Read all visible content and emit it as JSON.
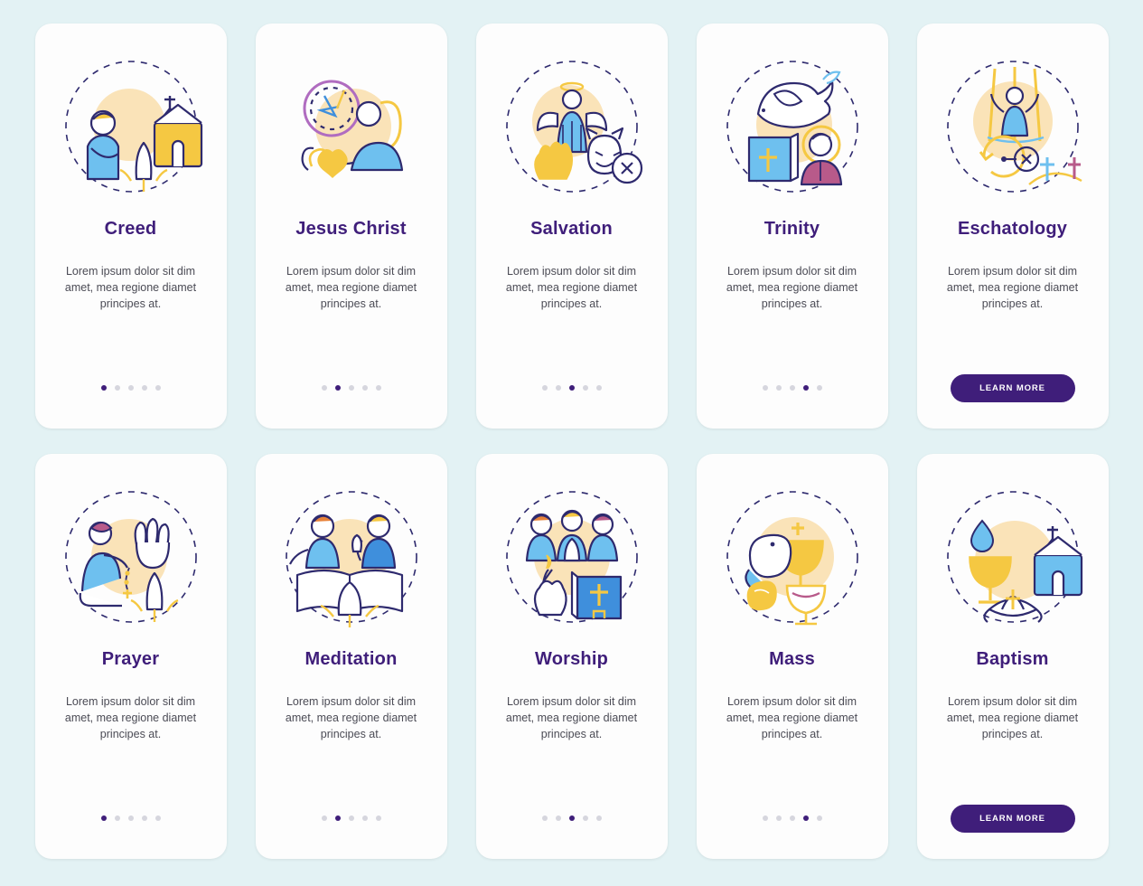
{
  "page": {
    "background": "#e3f2f4",
    "title_color": "#3f1e7a",
    "accent_yellow": "#f5c842",
    "accent_blue": "#4a9be0",
    "accent_peach": "#fae3b8"
  },
  "common": {
    "description": "Lorem ipsum dolor sit dim amet, mea regione diamet principes at.",
    "cta_label": "LEARN MORE"
  },
  "rows": [
    {
      "cards": [
        {
          "title": "Creed",
          "icon": "person-church-praying-icon",
          "active_dot": 0,
          "dot_count": 5,
          "has_cta": false
        },
        {
          "title": "Jesus Christ",
          "icon": "crown-of-thorns-heart-icon",
          "active_dot": 1,
          "dot_count": 5,
          "has_cta": false
        },
        {
          "title": "Salvation",
          "icon": "angel-devil-icon",
          "active_dot": 2,
          "dot_count": 5,
          "has_cta": false
        },
        {
          "title": "Trinity",
          "icon": "dove-bible-saint-icon",
          "active_dot": 3,
          "dot_count": 5,
          "has_cta": false
        },
        {
          "title": "Eschatology",
          "icon": "resurrection-clock-graves-icon",
          "active_dot": 4,
          "dot_count": 5,
          "has_cta": true
        }
      ]
    },
    {
      "cards": [
        {
          "title": "Prayer",
          "icon": "kneeling-rosary-hands-icon",
          "active_dot": 0,
          "dot_count": 5,
          "has_cta": false
        },
        {
          "title": "Meditation",
          "icon": "open-bible-two-people-icon",
          "active_dot": 1,
          "dot_count": 5,
          "has_cta": false
        },
        {
          "title": "Worship",
          "icon": "candle-bible-choir-icon",
          "active_dot": 2,
          "dot_count": 5,
          "has_cta": false
        },
        {
          "title": "Mass",
          "icon": "chalice-bread-wine-icon",
          "active_dot": 3,
          "dot_count": 5,
          "has_cta": false
        },
        {
          "title": "Baptism",
          "icon": "font-water-church-icon",
          "active_dot": 4,
          "dot_count": 5,
          "has_cta": true
        }
      ]
    }
  ]
}
